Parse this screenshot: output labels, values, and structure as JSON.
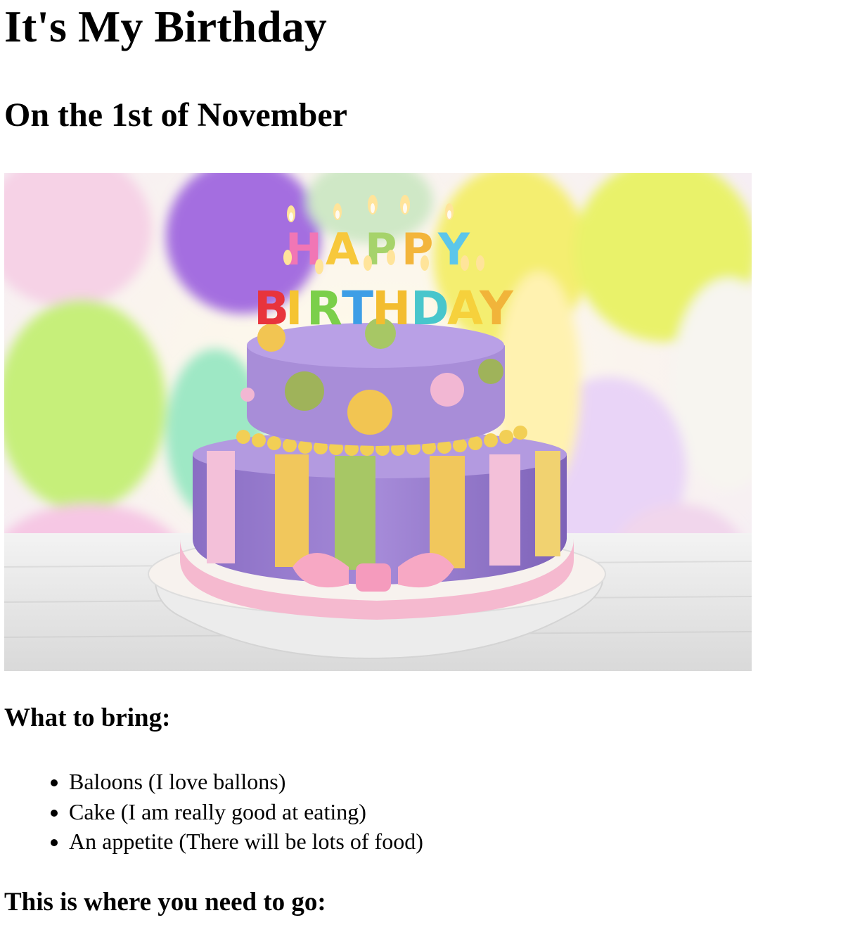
{
  "page": {
    "title": "It's My Birthday",
    "subtitle": "On the 1st of November"
  },
  "hero_image": {
    "icon": "birthday-cake-image",
    "candle_letters_top": [
      "H",
      "A",
      "P",
      "P",
      "Y"
    ],
    "candle_letters_bottom": [
      "B",
      "I",
      "R",
      "T",
      "H",
      "D",
      "A",
      "Y"
    ]
  },
  "bring": {
    "heading": "What to bring:",
    "items": [
      "Baloons (I love ballons)",
      "Cake (I am really good at eating)",
      "An appetite (There will be lots of food)"
    ]
  },
  "directions": {
    "heading": "This is where you need to go:"
  },
  "colors": {
    "text": "#000000",
    "background": "#ffffff"
  }
}
